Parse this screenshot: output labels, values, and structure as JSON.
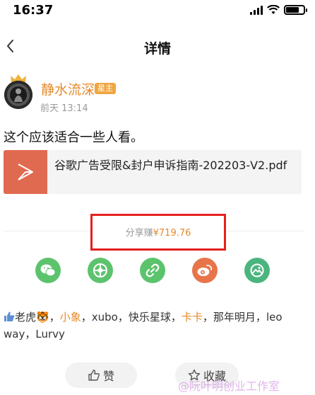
{
  "status_bar": {
    "time": "16:37",
    "battery_level": 0.75
  },
  "nav": {
    "title": "详情",
    "back_icon": "chevron-left-icon"
  },
  "post": {
    "author": "静水流深",
    "badge": "星主",
    "time": "前天 13:14",
    "text": "这个应该适合一些人看。",
    "file": {
      "name": "谷歌广告受限&封户申诉指南-202203-V2.pdf",
      "icon": "pdf-file-icon"
    }
  },
  "share": {
    "label": "分享赚",
    "amount": "¥719.76",
    "buttons": [
      {
        "name": "wechat",
        "icon": "wechat-icon",
        "color": "#5cc36d"
      },
      {
        "name": "moments",
        "icon": "moments-icon",
        "color": "#5cc36d"
      },
      {
        "name": "link",
        "icon": "link-icon",
        "color": "#5cc36d"
      },
      {
        "name": "weibo",
        "icon": "weibo-icon",
        "color": "#e8754a"
      },
      {
        "name": "image",
        "icon": "image-icon",
        "color": "#4cb57f"
      }
    ]
  },
  "likes": {
    "icon": "thumbs-up-icon",
    "users": [
      "老虎🐯",
      "小象",
      "xubo",
      "快乐星球",
      "卡卡",
      "那年明月",
      "leo way",
      "Lurvy"
    ],
    "separator": "，"
  },
  "actions": {
    "like": "赞",
    "favorite": "收藏"
  },
  "watermark": "@阮叶明创业工作室",
  "colors": {
    "accent": "#e58a2c",
    "highlight_box": "#e5201e",
    "pdf": "#e06a50"
  }
}
